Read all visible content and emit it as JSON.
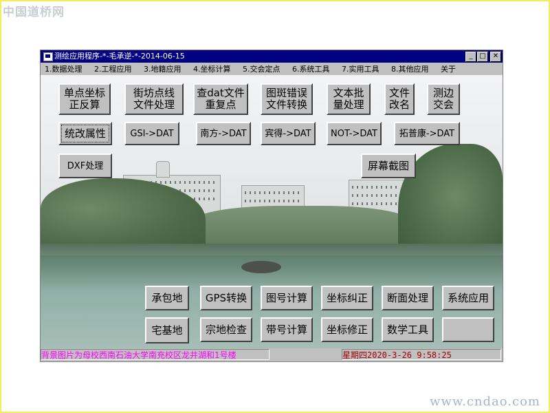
{
  "watermark_top": "中国道桥网",
  "watermark_bottom": "www.cndao.com",
  "window": {
    "title": "测绘应用程序-*-毛承逆-*-2014-06-15",
    "min_label": "_",
    "max_label": "□",
    "close_label": "✕"
  },
  "menu": [
    "1.数据处理",
    "2.工程应用",
    "3.地籍应用",
    "4.坐标计算",
    "5.交会定点",
    "6.系统工具",
    "7.实用工具",
    "8.其他应用",
    "关于"
  ],
  "buttons": {
    "row1": [
      "单点坐标\n正反算",
      "街坊点线\n文件处理",
      "查dat文件\n重复点",
      "图斑错误\n文件转换",
      "文本批\n量处理",
      "文件\n改名",
      "测边\n交会"
    ],
    "row2": [
      "统改属性",
      "GSI->DAT",
      "南方->DAT",
      "宾得->DAT",
      "NOT->DAT",
      "拓普康->DAT"
    ],
    "dxf": "DXF处理",
    "screenshot": "屏幕截图",
    "bottom_row1": [
      "承包地",
      "GPS转换",
      "图号计算",
      "坐标纠正",
      "断面处理",
      "系统应用"
    ],
    "bottom_row2": [
      "宅基地",
      "宗地检查",
      "带号计算",
      "坐标修正",
      "数学工具",
      ""
    ]
  },
  "status": {
    "left": "背景图片为母校西南石油大学南充校区龙井湖和1号楼",
    "right": "星期四2020-3-26 9:58:25"
  },
  "colors": {
    "titlebar": "#000080",
    "status_left_text": "#ff00ff",
    "status_right_text": "#a00000",
    "page_border": "#f2ee5a"
  }
}
